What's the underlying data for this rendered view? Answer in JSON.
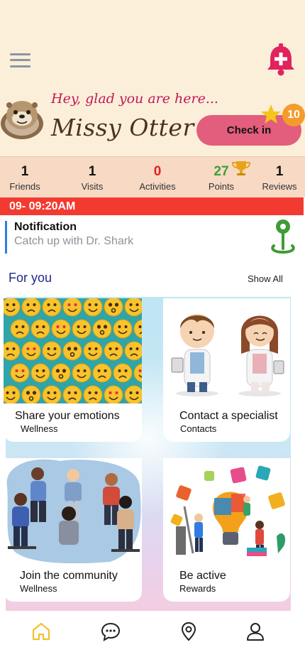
{
  "header": {
    "greeting": "Hey, glad you are here...",
    "user_name": "Missy Otter",
    "menu_icon": "hamburger-menu-icon",
    "notification_icon": "bell-plus-icon",
    "avatar_icon": "otter-avatar"
  },
  "checkin": {
    "label": "Check in",
    "points": "10",
    "star_icon": "star-icon"
  },
  "stats": [
    {
      "value": "1",
      "label": "Friends",
      "color": "#111111"
    },
    {
      "value": "1",
      "label": "Visits",
      "color": "#111111"
    },
    {
      "value": "0",
      "label": "Activities",
      "color": "#e02020"
    },
    {
      "value": "27",
      "label": "Points",
      "color": "#3aa33a"
    },
    {
      "value": "1",
      "label": "Reviews",
      "color": "#111111"
    }
  ],
  "time_bar": {
    "text": "09- 09:20AM",
    "color": "#f33a30"
  },
  "notification": {
    "title": "Notification",
    "message": "Catch up with Dr. Shark",
    "icon": "map-pin-icon"
  },
  "section": {
    "title": "For you",
    "show_all": "Show All"
  },
  "cards": [
    {
      "title": "Share your emotions",
      "category": "Wellness",
      "image": "emoji-faces-image"
    },
    {
      "title": "Contact a specialist",
      "category": "Contacts",
      "image": "doctors-image"
    },
    {
      "title": "Join the community",
      "category": "Wellness",
      "image": "support-group-image"
    },
    {
      "title": "Be active",
      "category": "Rewards",
      "image": "puzzle-team-image"
    }
  ],
  "tabbar": {
    "items": [
      {
        "icon": "home-icon",
        "active": true
      },
      {
        "icon": "chat-icon",
        "active": false
      },
      {
        "icon": "location-icon",
        "active": false
      },
      {
        "icon": "profile-icon",
        "active": false
      }
    ],
    "active_color": "#f2c12e"
  },
  "colors": {
    "accent_pink": "#e35d7c",
    "badge_orange": "#f49b2c",
    "brand_blue": "#222a8a",
    "header_bg": "#fbefd9",
    "stats_bg": "#f7d9c4"
  }
}
